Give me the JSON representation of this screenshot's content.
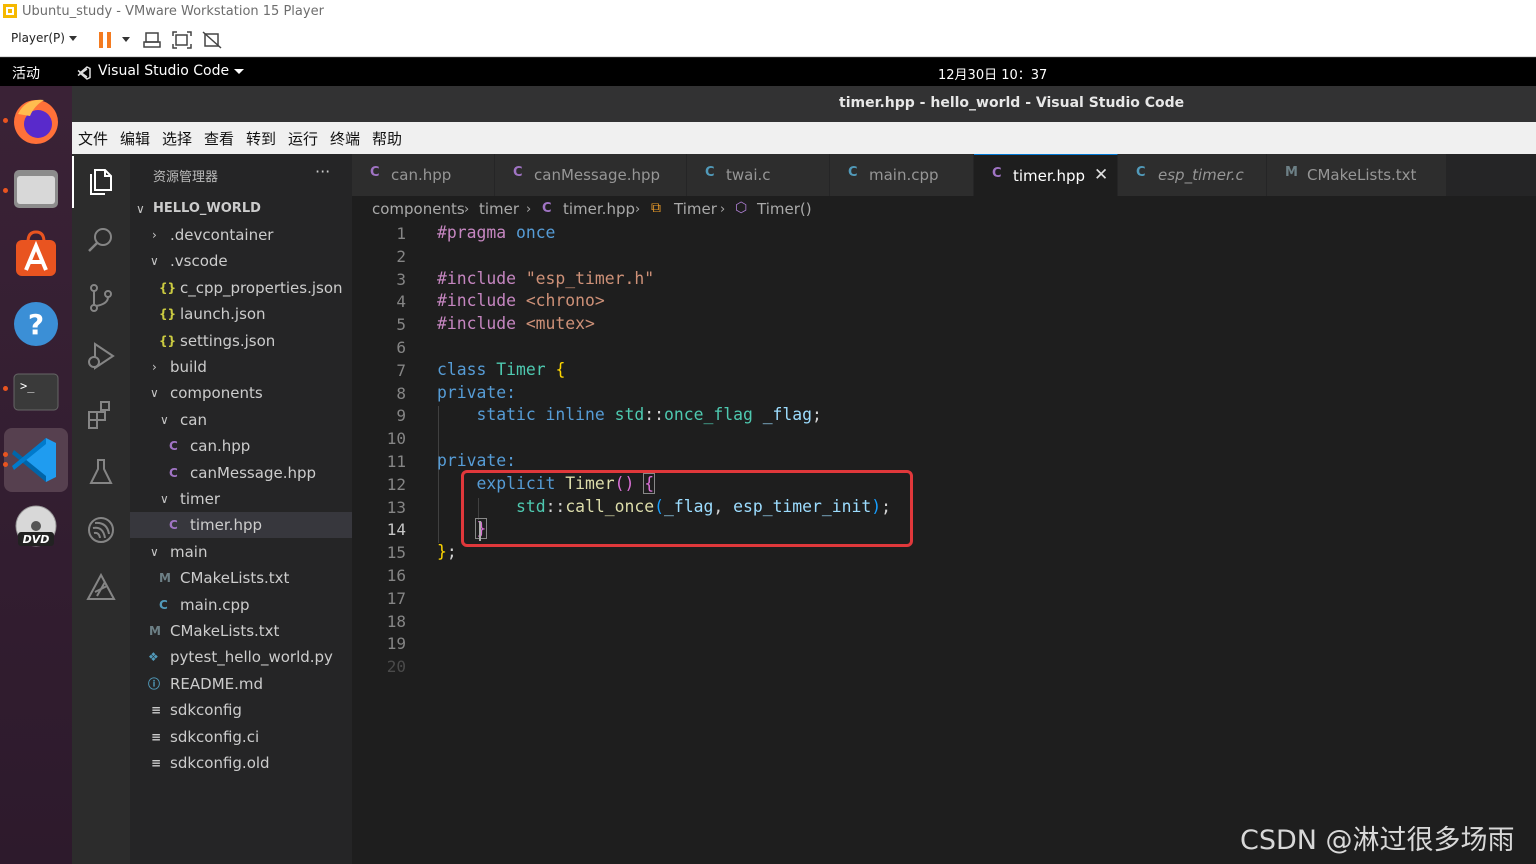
{
  "vm": {
    "title": "Ubuntu_study - VMware Workstation 15 Player",
    "player_menu": "Player(P)"
  },
  "gnome": {
    "activities": "活动",
    "app_name": "Visual Studio Code",
    "clock": "12月30日  10：37"
  },
  "vscode": {
    "window_title": "timer.hpp - hello_world - Visual Studio Code",
    "menu": [
      "文件",
      "编辑",
      "选择",
      "查看",
      "转到",
      "运行",
      "终端",
      "帮助"
    ]
  },
  "sidebar": {
    "header": "资源管理器",
    "more": "···",
    "root": "HELLO_WORLD",
    "items": [
      {
        "label": ".devcontainer",
        "icon": "chevron-right-icon"
      },
      {
        "label": ".vscode",
        "icon": "chevron-down-icon"
      },
      {
        "label": "c_cpp_properties.json",
        "icon": "json-icon"
      },
      {
        "label": "launch.json",
        "icon": "json-icon"
      },
      {
        "label": "settings.json",
        "icon": "json-icon"
      },
      {
        "label": "build",
        "icon": "chevron-right-icon"
      },
      {
        "label": "components",
        "icon": "chevron-down-icon"
      },
      {
        "label": "can",
        "icon": "chevron-down-icon"
      },
      {
        "label": "can.hpp",
        "icon": "cpp-icon"
      },
      {
        "label": "canMessage.hpp",
        "icon": "cpp-icon"
      },
      {
        "label": "timer",
        "icon": "chevron-down-icon"
      },
      {
        "label": "timer.hpp",
        "icon": "cpp-icon"
      },
      {
        "label": "main",
        "icon": "chevron-down-icon"
      },
      {
        "label": "CMakeLists.txt",
        "icon": "cmake-icon"
      },
      {
        "label": "main.cpp",
        "icon": "cpp-icon"
      },
      {
        "label": "CMakeLists.txt",
        "icon": "cmake-icon"
      },
      {
        "label": "pytest_hello_world.py",
        "icon": "python-icon"
      },
      {
        "label": "README.md",
        "icon": "info-icon"
      },
      {
        "label": "sdkconfig",
        "icon": "lines-icon"
      },
      {
        "label": "sdkconfig.ci",
        "icon": "lines-icon"
      },
      {
        "label": "sdkconfig.old",
        "icon": "lines-icon"
      }
    ]
  },
  "tabs": [
    {
      "label": "can.hpp",
      "icon": "C"
    },
    {
      "label": "canMessage.hpp",
      "icon": "C"
    },
    {
      "label": "twai.c",
      "icon": "C"
    },
    {
      "label": "main.cpp",
      "icon": "C"
    },
    {
      "label": "timer.hpp",
      "icon": "C",
      "close": "✕"
    },
    {
      "label": "esp_timer.c",
      "icon": "C"
    },
    {
      "label": "CMakeLists.txt",
      "icon": "M"
    }
  ],
  "breadcrumb": [
    "components",
    "timer",
    "timer.hpp",
    "Timer",
    "Timer()"
  ],
  "code": {
    "line_numbers": [
      "1",
      "2",
      "3",
      "4",
      "5",
      "6",
      "7",
      "8",
      "9",
      "10",
      "11",
      "12",
      "13",
      "14",
      "15",
      "16",
      "17",
      "18",
      "19",
      "20"
    ],
    "current_line": "14"
  },
  "watermark": "CSDN @淋过很多场雨",
  "colors": {
    "accent": "#0078d4",
    "highlight_box": "#e0383b",
    "ubuntu_orange": "#e95420"
  }
}
